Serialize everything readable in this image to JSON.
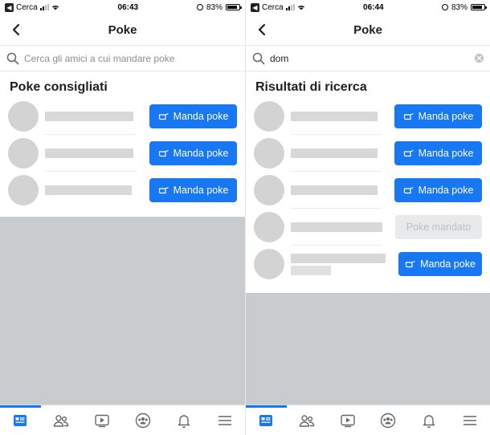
{
  "screens": [
    {
      "status": {
        "carrier": "Cerca",
        "time": "06:43",
        "battery": "83%",
        "battery_level": 0.83
      },
      "header": {
        "title": "Poke"
      },
      "search": {
        "value": "",
        "placeholder": "Cerca gli amici a cui mandare poke",
        "has_clear": false
      },
      "section_title": "Poke consigliati",
      "rows": [
        {
          "button_label": "Manda poke",
          "sent": false
        },
        {
          "button_label": "Manda poke",
          "sent": false
        },
        {
          "button_label": "Manda poke",
          "sent": false
        }
      ],
      "tabs": [
        "news-feed-icon",
        "friends-icon",
        "watch-icon",
        "groups-icon",
        "notifications-icon",
        "menu-icon"
      ],
      "active_tab": 0
    },
    {
      "status": {
        "carrier": "Cerca",
        "time": "06:44",
        "battery": "83%",
        "battery_level": 0.83
      },
      "header": {
        "title": "Poke"
      },
      "search": {
        "value": "dom",
        "placeholder": "",
        "has_clear": true
      },
      "section_title": "Risultati di ricerca",
      "rows": [
        {
          "button_label": "Manda poke",
          "sent": false
        },
        {
          "button_label": "Manda poke",
          "sent": false
        },
        {
          "button_label": "Manda poke",
          "sent": false
        },
        {
          "button_label": "Poke mandato",
          "sent": true
        },
        {
          "button_label": "Manda poke",
          "sent": false
        }
      ],
      "tabs": [
        "news-feed-icon",
        "friends-icon",
        "watch-icon",
        "groups-icon",
        "notifications-icon",
        "menu-icon"
      ],
      "active_tab": 0
    }
  ],
  "colors": {
    "accent": "#1877f2",
    "gray_area": "#c9cccf",
    "avatar": "#d3d3d3"
  }
}
